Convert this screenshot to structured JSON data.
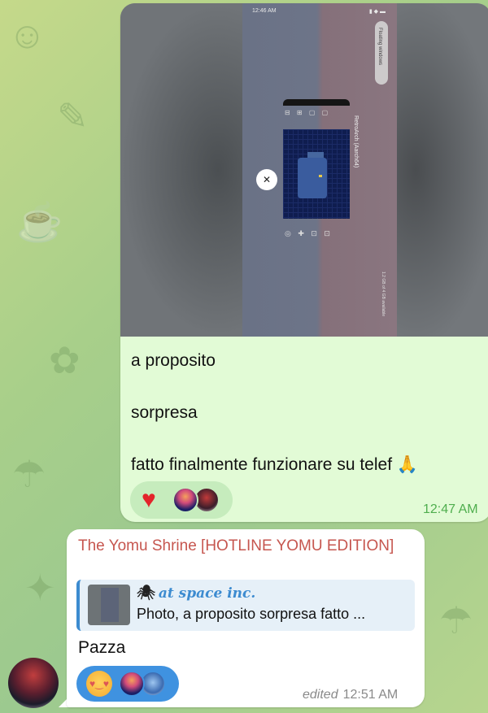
{
  "outgoing": {
    "photo": {
      "status_time": "12:46 AM",
      "floating_label": "Floating windows",
      "app_title": "RetroArch (Aarch64)",
      "storage_text": "1.2 GB of 4 GB available",
      "close_icon": "close-icon"
    },
    "caption_lines": [
      "a proposito",
      "sorpresa",
      "fatto finalmente funzionare su telef 🙏"
    ],
    "reactions": [
      "heart",
      "avatar",
      "avatar"
    ],
    "time": "12:47 AM"
  },
  "incoming": {
    "sender": "The Yomu Shrine [HOTLINE YOMU EDITION]",
    "reply": {
      "author": "at space inc.",
      "text": "Photo, a proposito sorpresa fatto ..."
    },
    "text": "Pazza",
    "reactions": [
      "smiling-face-with-hearts",
      "avatar",
      "avatar"
    ],
    "edited_label": "edited",
    "time": "12:51 AM"
  },
  "colors": {
    "outgoing_bubble": "#e2fbd6",
    "incoming_bubble": "#ffffff",
    "sender_name": "#c6564f",
    "link_blue": "#3c8bd0",
    "time_green": "#4fae4e"
  }
}
